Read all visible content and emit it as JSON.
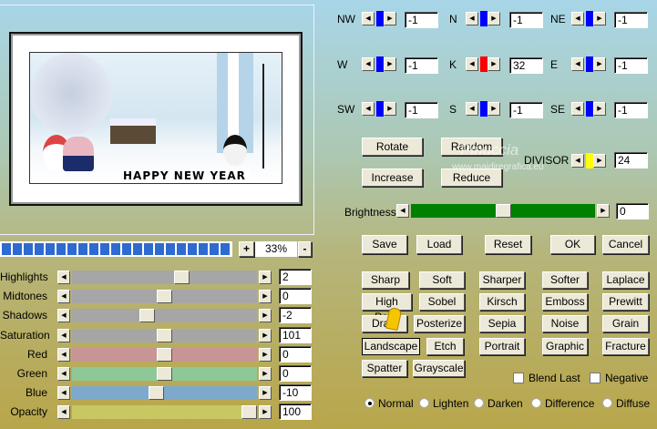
{
  "preview": {
    "caption": "HAPPY NEW YEAR",
    "zoom": "33%",
    "zoom_in": "+",
    "zoom_out": "-",
    "progress_fraction": 1.0
  },
  "matrix": [
    {
      "label": "NW",
      "value": "-1",
      "color": "#0000ff"
    },
    {
      "label": "N",
      "value": "-1",
      "color": "#0000ff"
    },
    {
      "label": "NE",
      "value": "-1",
      "color": "#0000ff"
    },
    {
      "label": "W",
      "value": "-1",
      "color": "#0000ff"
    },
    {
      "label": "K",
      "value": "32",
      "color": "#ff0000"
    },
    {
      "label": "E",
      "value": "-1",
      "color": "#0000ff"
    },
    {
      "label": "SW",
      "value": "-1",
      "color": "#0000ff"
    },
    {
      "label": "S",
      "value": "-1",
      "color": "#0000ff"
    },
    {
      "label": "SE",
      "value": "-1",
      "color": "#0000ff"
    }
  ],
  "divisor": {
    "label": "DIVISOR",
    "value": "24",
    "color": "#ffff00"
  },
  "matrix_buttons": {
    "rotate": "Rotate",
    "random": "Random",
    "increase": "Increase",
    "reduce": "Reduce"
  },
  "watermark": {
    "name": "Pinuccia",
    "url": "www.maidiregrafica.eu"
  },
  "brightness": {
    "label": "Brightness",
    "value": "0",
    "position": 0.5,
    "color": "#008000"
  },
  "actions": {
    "save": "Save",
    "load": "Load",
    "reset": "Reset",
    "ok": "OK",
    "cancel": "Cancel"
  },
  "sliders": [
    {
      "label": "Highlights",
      "value": "2",
      "position": 0.6,
      "color": "#a6a6a6"
    },
    {
      "label": "Midtones",
      "value": "0",
      "position": 0.5,
      "color": "#a6a6a6"
    },
    {
      "label": "Shadows",
      "value": "-2",
      "position": 0.4,
      "color": "#a6a6a6"
    },
    {
      "label": "Saturation",
      "value": "101",
      "position": 0.5,
      "color": "#a6a6a6"
    },
    {
      "label": "Red",
      "value": "0",
      "position": 0.5,
      "color": "#c99495"
    },
    {
      "label": "Green",
      "value": "0",
      "position": 0.5,
      "color": "#8fc897"
    },
    {
      "label": "Blue",
      "value": "-10",
      "position": 0.45,
      "color": "#7ea9cc"
    },
    {
      "label": "Opacity",
      "value": "100",
      "position": 1.0,
      "color": "#c8c862"
    }
  ],
  "presets": [
    "Sharp",
    "Soft",
    "Sharper",
    "Softer",
    "Laplace",
    "High Pass",
    "Sobel",
    "Kirsch",
    "Emboss",
    "Prewitt",
    "Draw",
    "Posterize",
    "Sepia",
    "Noise",
    "Grain",
    "Landscape",
    "Etch",
    "Portrait",
    "Graphic",
    "Fracture",
    "Spatter",
    "Grayscale"
  ],
  "selected_preset": "Landscape",
  "checkboxes": [
    {
      "label": "Blend Last",
      "checked": false
    },
    {
      "label": "Negative",
      "checked": false
    }
  ],
  "modes": [
    {
      "label": "Normal",
      "selected": true
    },
    {
      "label": "Lighten",
      "selected": false
    },
    {
      "label": "Darken",
      "selected": false
    },
    {
      "label": "Difference",
      "selected": false
    },
    {
      "label": "Diffuse",
      "selected": false
    }
  ]
}
